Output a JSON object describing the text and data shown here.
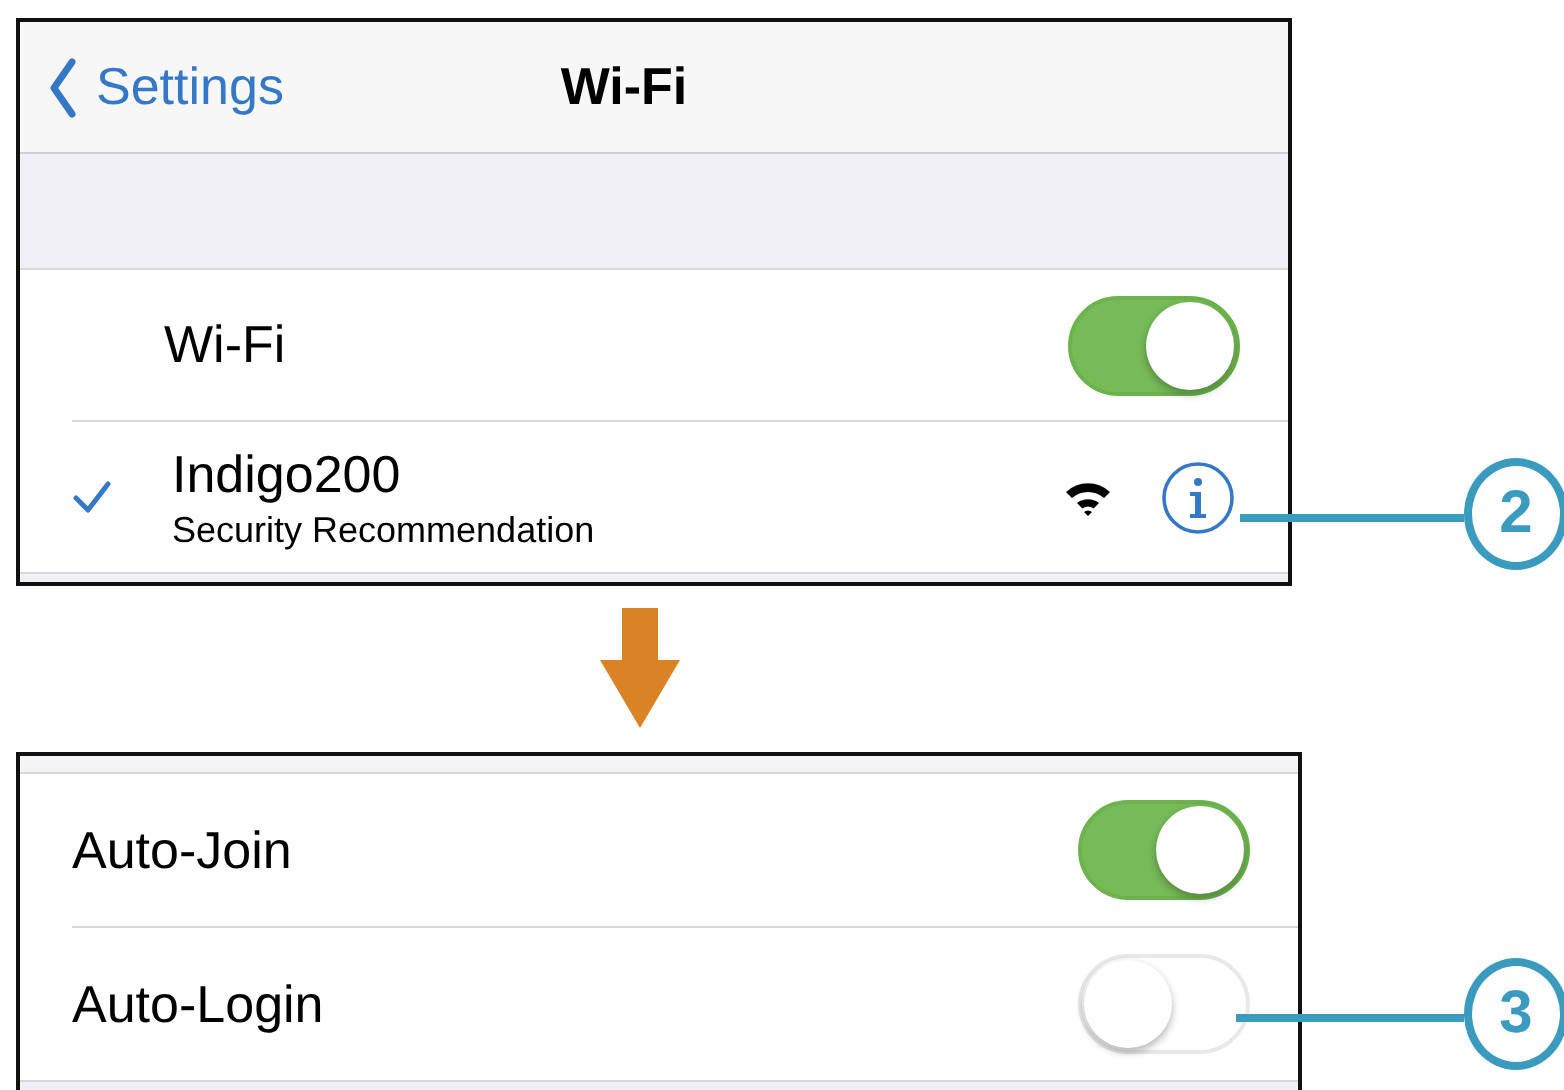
{
  "nav": {
    "back": "Settings",
    "title": "Wi-Fi"
  },
  "wifi_row": {
    "label": "Wi-Fi",
    "on": true
  },
  "network": {
    "name": "Indigo200",
    "subtitle": "Security Recommendation",
    "selected": true
  },
  "settings": [
    {
      "label": "Auto-Join",
      "on": true
    },
    {
      "label": "Auto-Login",
      "on": false
    }
  ],
  "callouts": [
    {
      "number": "2"
    },
    {
      "number": "3"
    }
  ]
}
